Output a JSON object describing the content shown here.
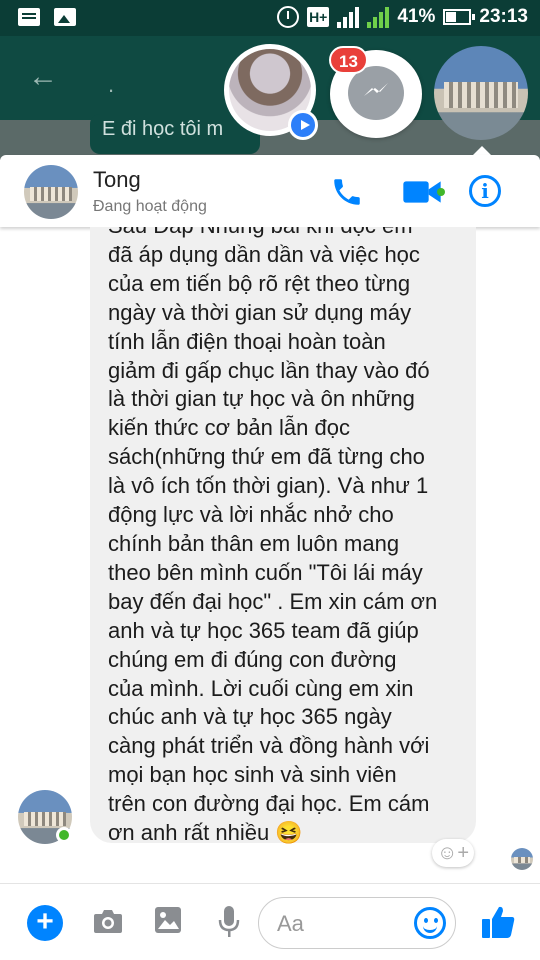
{
  "status_bar": {
    "network": "H+",
    "sim1": "1",
    "sim2": "2",
    "battery": "41%",
    "time": "23:13"
  },
  "background": {
    "back_icon": "arrow-left-icon",
    "preview_text": "E đi học tôi m",
    "dot": "."
  },
  "chat_heads": {
    "unread_badge": "13",
    "messenger_icon": "messenger-bolt-icon"
  },
  "conversation": {
    "name": "Tong",
    "status": "Đang hoạt động",
    "actions": [
      "phone-icon",
      "video-camera-icon",
      "info-icon"
    ]
  },
  "message": {
    "text": "Sau Đap Nhung bai khi đọc em\nđã áp dụng dần dần và việc học\ncủa em tiến bộ rõ rệt theo từng\nngày và thời gian sử dụng máy\ntính lẫn điện thoại hoàn toàn\ngiảm đi gấp chục lần thay vào đó\nlà thời gian tự học và ôn những\nkiến thức cơ bản lẫn đọc\nsách(những thứ em đã từng cho\nlà vô ích tốn thời gian). Và như 1\nđộng lực và lời nhắc nhở cho\nchính bản thân em luôn mang\ntheo bên mình cuốn \"Tôi lái máy\nbay đến đại học\" . Em xin cám ơn\nanh và tự học 365 team đã giúp\nchúng em đi đúng con đường\ncủa mình. Lời cuối cùng em xin\nchúc anh và tự học 365 ngày\ncàng phát triển và đồng hành với\nmọi bạn học sinh và sinh viên\ntrên con đường đại học. Em cám\nơn anh rất nhiều 😆"
  },
  "composer": {
    "placeholder": "Aa",
    "react_symbol": "☺+"
  },
  "colors": {
    "accent": "#0084ff",
    "status_bar": "#0b3d36",
    "online": "#42b72a",
    "badge": "#e9403a",
    "bubble": "#f0f0f0"
  }
}
